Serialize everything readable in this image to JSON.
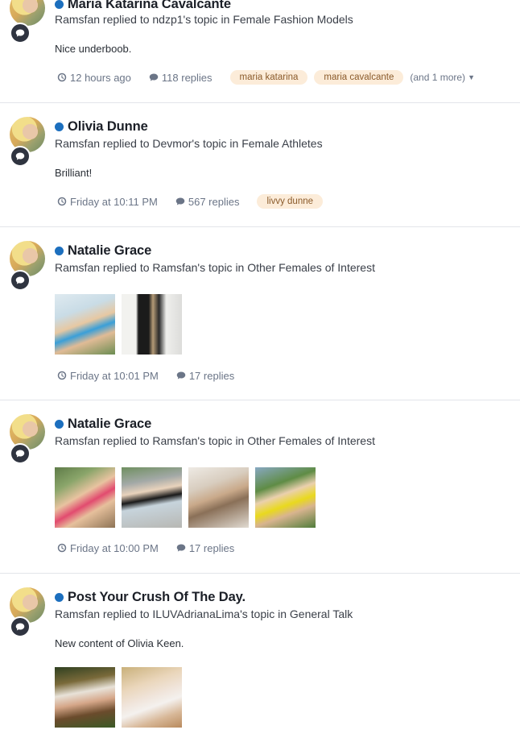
{
  "items": [
    {
      "title": "Maria Katarina Cavalcante",
      "subline": "Ramsfan replied to ndzp1's topic in Female Fashion Models",
      "snippet": "Nice underboob.",
      "time": "12 hours ago",
      "replies": "118 replies",
      "tags": [
        "maria katarina",
        "maria cavalcante"
      ],
      "more": "(and 1 more)"
    },
    {
      "title": "Olivia Dunne",
      "subline": "Ramsfan replied to Devmor's topic in Female Athletes",
      "snippet": "Brilliant!",
      "time": "Friday at 10:11 PM",
      "replies": "567 replies",
      "tags": [
        "livvy dunne"
      ]
    },
    {
      "title": "Natalie Grace",
      "subline": "Ramsfan replied to Ramsfan's topic in Other Females of Interest",
      "time": "Friday at 10:01 PM",
      "replies": "17 replies"
    },
    {
      "title": "Natalie Grace",
      "subline": "Ramsfan replied to Ramsfan's topic in Other Females of Interest",
      "time": "Friday at 10:00 PM",
      "replies": "17 replies"
    },
    {
      "title": "Post Your Crush Of The Day.",
      "subline": "Ramsfan replied to ILUVAdrianaLima's topic in General Talk",
      "snippet": "New content of Olivia Keen."
    }
  ],
  "icons": {
    "avatar_badge": "comment-icon",
    "time": "clock-icon",
    "replies": "comment-icon",
    "more": "caret-down-icon"
  },
  "colors": {
    "online_dot": "#1c6fbe",
    "tag_bg": "#fcecd9",
    "meta_text": "#6b7587"
  }
}
